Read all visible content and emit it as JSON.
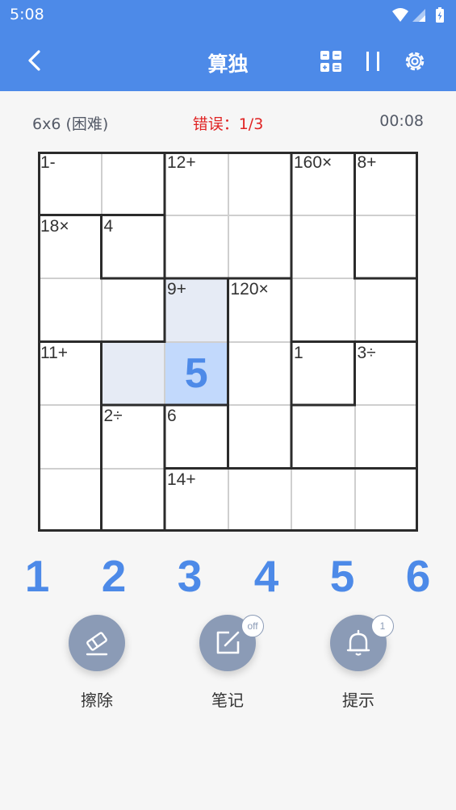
{
  "status": {
    "time": "5:08"
  },
  "appbar": {
    "title": "算独",
    "back_icon": "arrow-back-icon",
    "actions": [
      "grid-view-icon",
      "pause-icon",
      "settings-icon"
    ]
  },
  "info": {
    "level": "6x6 (困难)",
    "errors": "错误：1/3",
    "timer": "00:08"
  },
  "colors": {
    "primary": "#4d8ae8",
    "error": "#e02424",
    "selected_cell": "#c2d9fc",
    "highlight_cell": "#e6ebf5",
    "tool_button": "#8b9bb6"
  },
  "puzzle": {
    "size": 6,
    "clues": [
      {
        "row": 0,
        "col": 0,
        "text": "1-"
      },
      {
        "row": 0,
        "col": 2,
        "text": "12+"
      },
      {
        "row": 0,
        "col": 4,
        "text": "160×"
      },
      {
        "row": 0,
        "col": 5,
        "text": "8+"
      },
      {
        "row": 1,
        "col": 0,
        "text": "18×"
      },
      {
        "row": 1,
        "col": 1,
        "text": "4"
      },
      {
        "row": 2,
        "col": 2,
        "text": "9+"
      },
      {
        "row": 2,
        "col": 3,
        "text": "120×"
      },
      {
        "row": 3,
        "col": 0,
        "text": "11+"
      },
      {
        "row": 3,
        "col": 4,
        "text": "1"
      },
      {
        "row": 3,
        "col": 5,
        "text": "3÷"
      },
      {
        "row": 4,
        "col": 1,
        "text": "2÷"
      },
      {
        "row": 4,
        "col": 2,
        "text": "6"
      },
      {
        "row": 5,
        "col": 2,
        "text": "14+"
      }
    ],
    "values": [
      {
        "row": 3,
        "col": 2,
        "value": "5"
      }
    ],
    "selected": {
      "row": 3,
      "col": 2
    },
    "highlighted": [
      {
        "row": 2,
        "col": 2
      },
      {
        "row": 3,
        "col": 1
      }
    ],
    "cages": [
      [
        [
          0,
          0
        ],
        [
          0,
          1
        ]
      ],
      [
        [
          0,
          2
        ],
        [
          0,
          3
        ],
        [
          1,
          2
        ],
        [
          1,
          3
        ]
      ],
      [
        [
          0,
          4
        ],
        [
          1,
          4
        ],
        [
          2,
          4
        ],
        [
          2,
          5
        ]
      ],
      [
        [
          0,
          5
        ],
        [
          1,
          5
        ]
      ],
      [
        [
          1,
          0
        ],
        [
          2,
          0
        ],
        [
          2,
          1
        ]
      ],
      [
        [
          1,
          1
        ]
      ],
      [
        [
          2,
          2
        ],
        [
          3,
          2
        ],
        [
          3,
          1
        ]
      ],
      [
        [
          2,
          3
        ],
        [
          3,
          3
        ],
        [
          4,
          3
        ]
      ],
      [
        [
          3,
          0
        ],
        [
          4,
          0
        ],
        [
          5,
          0
        ]
      ],
      [
        [
          3,
          4
        ]
      ],
      [
        [
          3,
          5
        ],
        [
          4,
          5
        ],
        [
          4,
          4
        ]
      ],
      [
        [
          4,
          1
        ],
        [
          5,
          1
        ]
      ],
      [
        [
          4,
          2
        ]
      ],
      [
        [
          5,
          2
        ],
        [
          5,
          3
        ],
        [
          5,
          4
        ],
        [
          5,
          5
        ]
      ]
    ]
  },
  "numpad": [
    "1",
    "2",
    "3",
    "4",
    "5",
    "6"
  ],
  "tools": [
    {
      "label": "擦除",
      "icon": "eraser-icon"
    },
    {
      "label": "笔记",
      "icon": "edit-note-icon",
      "badge": "off"
    },
    {
      "label": "提示",
      "icon": "bell-icon",
      "badge": "1"
    }
  ]
}
